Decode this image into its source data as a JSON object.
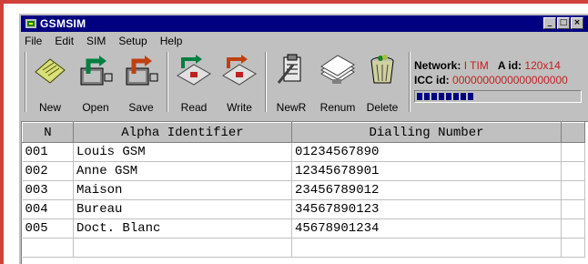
{
  "window": {
    "title": "GSMSIM",
    "controls": [
      "minimize-icon",
      "maximize-icon",
      "close-icon"
    ]
  },
  "menu": [
    "File",
    "Edit",
    "SIM",
    "Setup",
    "Help"
  ],
  "toolbar": {
    "new_label": "New",
    "open_label": "Open",
    "save_label": "Save",
    "read_label": "Read",
    "write_label": "Write",
    "newr_label": "NewR",
    "renum_label": "Renum",
    "delete_label": "Delete"
  },
  "status": {
    "network_label": "Network:",
    "network_value": "I TIM",
    "aid_label": "A id:",
    "aid_value": "120x14",
    "icc_label": "ICC id:",
    "icc_value": "0000000000000000000",
    "progress_blocks": 8,
    "accent_color": "#c02020"
  },
  "table": {
    "columns": [
      "N",
      "Alpha Identifier",
      "Dialling Number"
    ],
    "rows": [
      [
        "001",
        "Louis GSM",
        "01234567890"
      ],
      [
        "002",
        "Anne GSM",
        "12345678901"
      ],
      [
        "003",
        "Maison",
        "23456789012"
      ],
      [
        "004",
        "Bureau",
        "34567890123"
      ],
      [
        "005",
        "Doct. Blanc",
        "45678901234"
      ]
    ]
  }
}
